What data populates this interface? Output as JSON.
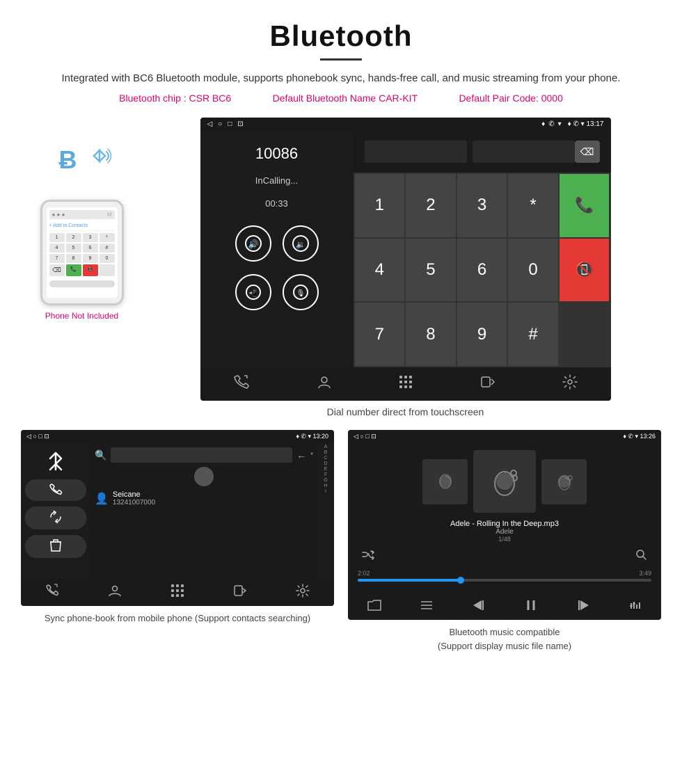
{
  "header": {
    "title": "Bluetooth",
    "description": "Integrated with BC6 Bluetooth module, supports phonebook sync, hands-free call, and music streaming from your phone.",
    "spec_chip": "Bluetooth chip : CSR BC6",
    "spec_name": "Default Bluetooth Name CAR-KIT",
    "spec_code": "Default Pair Code: 0000"
  },
  "main_screen": {
    "status_bar": {
      "nav_icons": "◁  ○  □  ⊡",
      "right": "♦ ✆ ▾ 13:17"
    },
    "call_number": "10086",
    "call_status": "InCalling...",
    "call_timer": "00:33",
    "dialer_keys": [
      "1",
      "2",
      "3",
      "*",
      "4",
      "5",
      "6",
      "0",
      "7",
      "8",
      "9",
      "#"
    ],
    "caption": "Dial number direct from touchscreen"
  },
  "phone_not_included": "Phone Not Included",
  "phonebook_screen": {
    "status_bar_left": "◁  ○  □  ⊡",
    "status_bar_right": "♦ ✆ ▾ 13:20",
    "contact_name": "Seicane",
    "contact_number": "13241007000",
    "alphabet": [
      "A",
      "B",
      "C",
      "D",
      "E",
      "F",
      "G",
      "H",
      "I"
    ],
    "caption": "Sync phone-book from mobile phone\n(Support contacts searching)"
  },
  "music_screen": {
    "status_bar_left": "◁  ○  □  ⊡",
    "status_bar_right": "♦ ✆ ▾ 13:26",
    "song_title": "Adele - Rolling In the Deep.mp3",
    "artist": "Adele",
    "track": "1/48",
    "time_current": "2:02",
    "time_total": "3:49",
    "caption": "Bluetooth music compatible\n(Support display music file name)"
  }
}
